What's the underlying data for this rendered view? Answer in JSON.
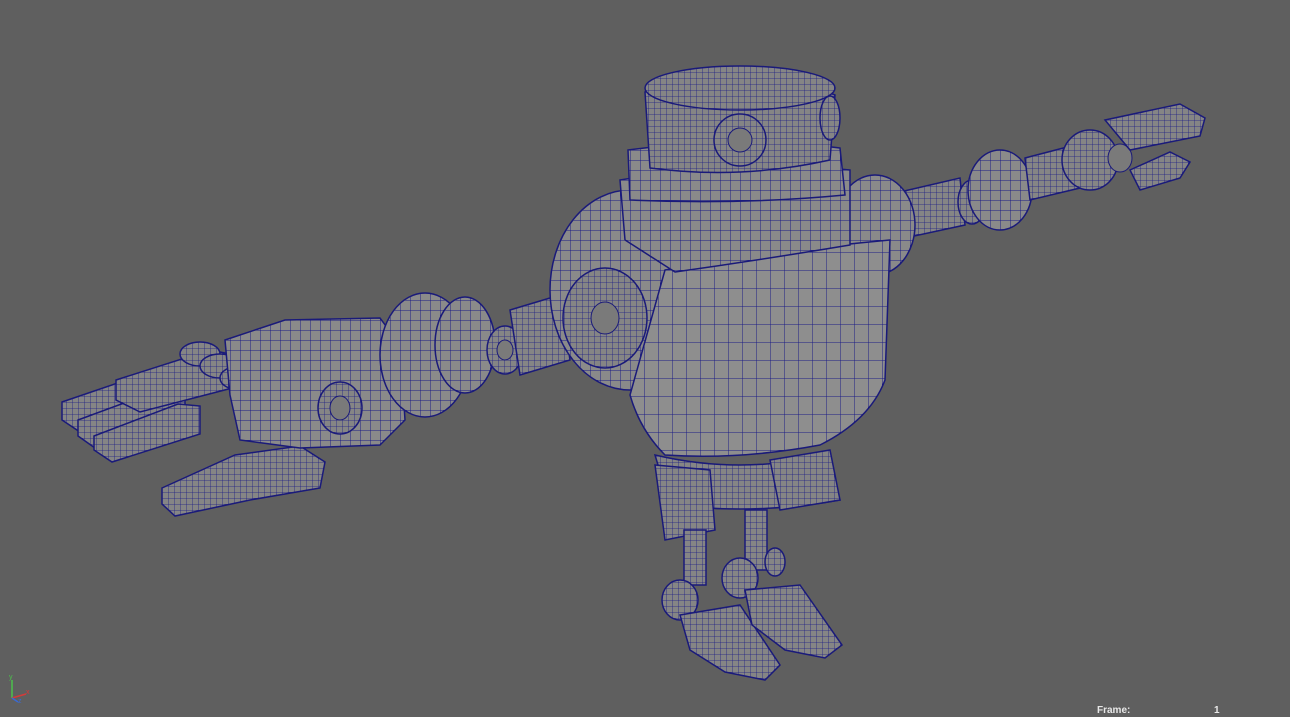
{
  "viewport": {
    "background": "#5f5f5f",
    "wire_color": "#1a1a7a",
    "shaded_color": "#8c8c8c"
  },
  "model": {
    "name_icon": "robot-wireframe-model",
    "shading": "wireframe-on-shaded"
  },
  "axis": {
    "x_label": "x",
    "y_label": "y",
    "z_label": "z",
    "x_color": "#d43a3a",
    "y_color": "#4cc04c",
    "z_color": "#3a6ad4"
  },
  "hud": {
    "frame_label": "Frame:",
    "frame_value": "1"
  }
}
